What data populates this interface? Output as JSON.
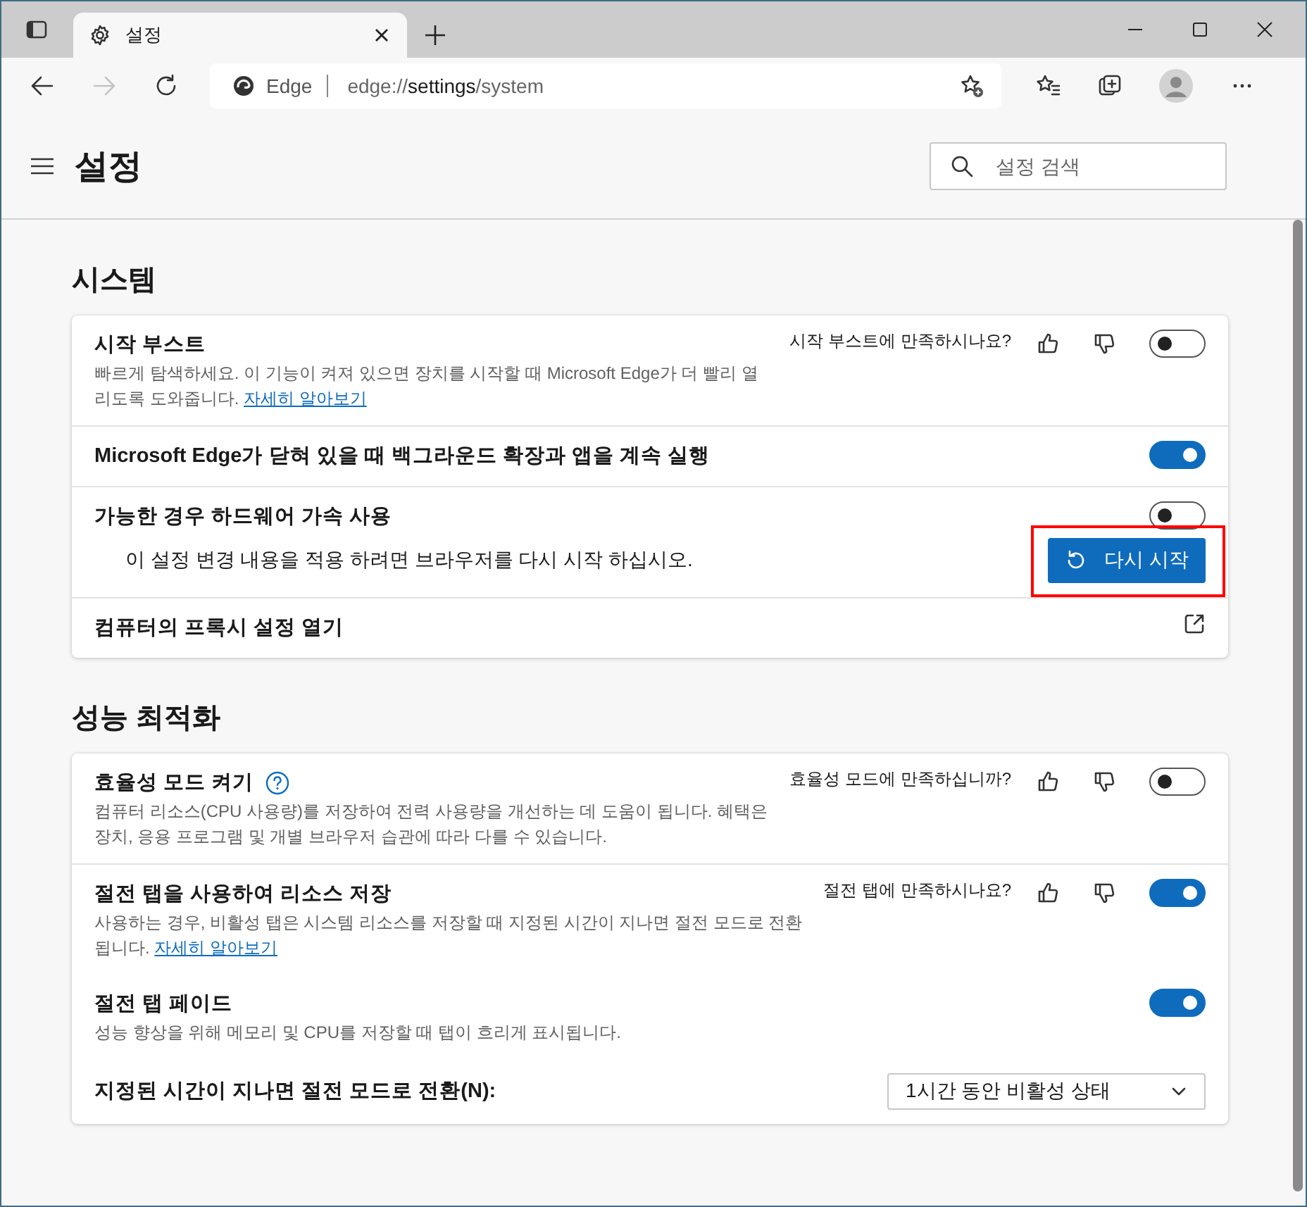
{
  "tab_strip": {
    "tab": {
      "title": "설정"
    }
  },
  "toolbar": {
    "forward_disabled": true,
    "site_label": "Edge",
    "url": [
      {
        "text": "edge://",
        "emphasis": false
      },
      {
        "text": "settings",
        "emphasis": true
      },
      {
        "text": "/system",
        "emphasis": false
      }
    ]
  },
  "page": {
    "title": "설정",
    "search": {
      "placeholder": "설정 검색"
    }
  },
  "sections": [
    {
      "title": "시스템",
      "rows": [
        {
          "kind": "toggle",
          "divider": false,
          "title": "시작 부스트",
          "description": "빠르게 탐색하세요. 이 기능이 켜져 있으면 장치를 시작할 때 Microsoft Edge가 더 빨리 열리도록 도와줍니다.",
          "link": "자세히 알아보기",
          "feedback": "시작 부스트에 만족하시나요?",
          "on": false
        },
        {
          "kind": "toggle",
          "divider": true,
          "title": "Microsoft Edge가 닫혀 있을 때 백그라운드 확장과 앱을 계속 실행",
          "on": true
        },
        {
          "kind": "toggle",
          "divider": true,
          "title": "가능한 경우 하드웨어 가속 사용",
          "on": false,
          "notice": "이 설정 변경 내용을 적용 하려면 브라우저를 다시 시작 하십시오.",
          "button": {
            "label": "다시 시작",
            "highlighted": true
          }
        },
        {
          "kind": "link",
          "divider": true,
          "title": "컴퓨터의 프록시 설정 열기"
        }
      ]
    },
    {
      "title": "성능 최적화",
      "rows": [
        {
          "kind": "toggle",
          "divider": false,
          "title": "효율성 모드 켜기",
          "help": true,
          "description": "컴퓨터 리소스(CPU 사용량)를 저장하여 전력 사용량을 개선하는 데 도움이 됩니다. 혜택은 장치, 응용 프로그램 및 개별 브라우저 습관에 따라 다를 수 있습니다.",
          "feedback": "효율성 모드에 만족하십니까?",
          "on": false
        },
        {
          "kind": "toggle",
          "divider": true,
          "title": "절전 탭을 사용하여 리소스 저장",
          "description": "사용하는 경우, 비활성 탭은 시스템 리소스를 저장할 때 지정된 시간이 지나면 절전 모드로 전환됩니다.",
          "link": "자세히 알아보기",
          "feedback": "절전 탭에 만족하시나요?",
          "on": true
        },
        {
          "kind": "toggle",
          "divider": false,
          "title": "절전 탭 페이드",
          "description": "성능 향상을 위해 메모리 및 CPU를 저장할 때 탭이 흐리게 표시됩니다.",
          "on": true
        },
        {
          "kind": "select",
          "divider": false,
          "title": "지정된 시간이 지나면 절전 모드로 전환(N):",
          "value": "1시간 동안 비활성 상태"
        }
      ]
    }
  ]
}
